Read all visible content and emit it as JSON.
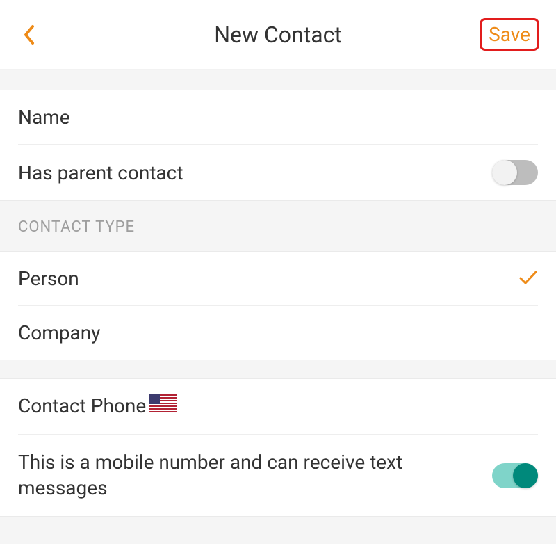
{
  "header": {
    "title": "New Contact",
    "save_label": "Save"
  },
  "fields": {
    "name_label": "Name",
    "has_parent_label": "Has parent contact",
    "has_parent_value": false
  },
  "contact_type": {
    "section_label": "CONTACT TYPE",
    "options": {
      "person": "Person",
      "company": "Company"
    },
    "selected": "person"
  },
  "phone": {
    "label": "Contact Phone",
    "flag": "us",
    "mobile_text_label": "This is a mobile number and can receive text messages",
    "mobile_text_value": true
  }
}
